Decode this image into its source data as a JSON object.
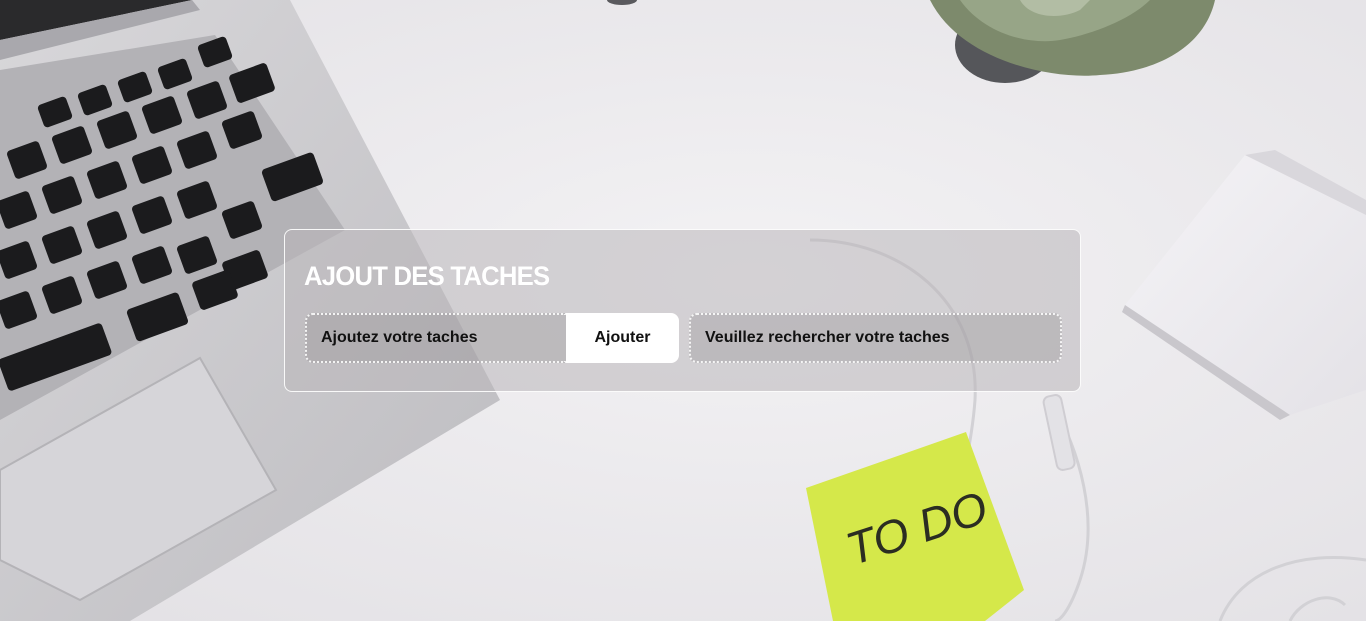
{
  "background": {
    "sticky_note_text": "TO DO",
    "colors": {
      "desk": "#ebe9ec",
      "laptop_body": "#c9c8cb",
      "keys": "#1c1c1e",
      "sticky_note": "#d5e84a",
      "plant": "#7c8b6b"
    }
  },
  "panel": {
    "title": "AJOUT DES TACHES",
    "add_input_placeholder": "Ajoutez votre taches",
    "add_button_label": "Ajouter",
    "search_input_placeholder": "Veuillez rechercher votre taches"
  }
}
